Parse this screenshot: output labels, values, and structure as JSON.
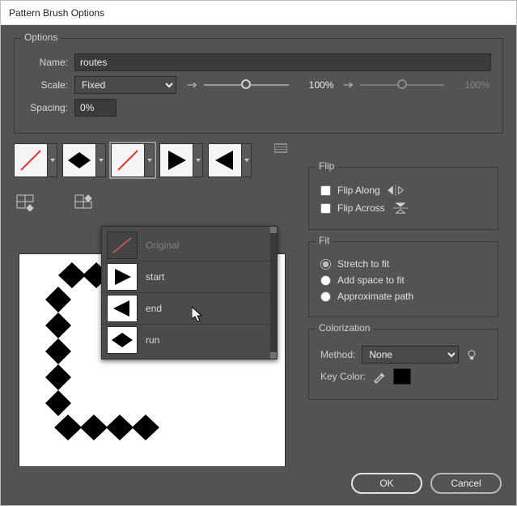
{
  "window": {
    "title": "Pattern Brush Options"
  },
  "options": {
    "legend": "Options",
    "name_label": "Name:",
    "name_value": "routes",
    "scale_label": "Scale:",
    "scale_mode": "Fixed",
    "scale_value": "100%",
    "scale_value2": "100%",
    "spacing_label": "Spacing:",
    "spacing_value": "0%"
  },
  "tiles": {
    "menu": {
      "original": "Original",
      "start": "start",
      "end": "end",
      "run": "run"
    }
  },
  "flip": {
    "legend": "Flip",
    "along": "Flip Along",
    "across": "Flip Across"
  },
  "fit": {
    "legend": "Fit",
    "stretch": "Stretch to fit",
    "addspace": "Add space to fit",
    "approx": "Approximate path"
  },
  "colorization": {
    "legend": "Colorization",
    "method_label": "Method:",
    "method_value": "None",
    "keycolor_label": "Key Color:"
  },
  "footer": {
    "ok": "OK",
    "cancel": "Cancel"
  }
}
